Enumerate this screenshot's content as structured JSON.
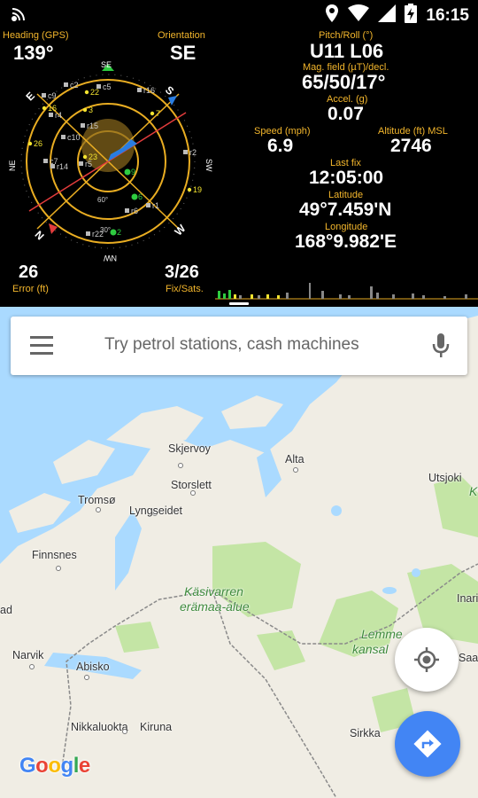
{
  "status_bar": {
    "time": "16:15",
    "icons": [
      "location-icon",
      "wifi-icon",
      "cell-signal-icon",
      "battery-charging-icon"
    ]
  },
  "gps": {
    "heading": {
      "label": "Heading (GPS)",
      "value": "139°"
    },
    "orientation": {
      "label": "Orientation",
      "value": "SE"
    },
    "pitch_roll": {
      "label": "Pitch/Roll (°)",
      "value": "U11 L06"
    },
    "mag_field": {
      "label": "Mag. field (µT)/decl.",
      "value": "65/50/17°"
    },
    "accel": {
      "label": "Accel. (g)",
      "value": "0.07"
    },
    "speed": {
      "label": "Speed (mph)",
      "value": "6.9"
    },
    "altitude": {
      "label": "Altitude (ft) MSL",
      "value": "2746"
    },
    "last_fix": {
      "label": "Last fix",
      "value": "12:05:00"
    },
    "latitude": {
      "label": "Latitude",
      "value": "49°7.459'N"
    },
    "longitude": {
      "label": "Longitude",
      "value": "168°9.982'E"
    },
    "error": {
      "label": "Error (ft)",
      "value": "26"
    },
    "fix_sats": {
      "label": "Fix/Sats.",
      "value": "3/26"
    },
    "compass": {
      "cardinals": {
        "n": "N",
        "e": "E",
        "s": "S",
        "w": "W",
        "ne": "NE",
        "se": "SE",
        "sw": "SW",
        "nw": "NW"
      },
      "ring_labels": {
        "inner": "60°",
        "outer": "30°"
      },
      "satellites": [
        "c9",
        "c2",
        "22",
        "c5",
        "r16",
        "16",
        "r4",
        "3",
        "7",
        "c10",
        "r15",
        "26",
        "c7",
        "23",
        "r5",
        "r14",
        "r2",
        "9",
        "6",
        "19",
        "r6",
        "r1",
        "r22",
        "2"
      ]
    },
    "colors": {
      "label": "#f3b62c",
      "ring": "#e9ad22",
      "pointer_red": "#e23c3c",
      "pointer_blue": "#2a7de1",
      "sat_green": "#2ecc40",
      "sat_yellow": "#f4e430"
    }
  },
  "map": {
    "search_placeholder": "Try petrol stations, cash machines",
    "places": {
      "skjervoy": "Skjervoy",
      "alta": "Alta",
      "tromso": "Tromsø",
      "storslett": "Storslett",
      "lyngseidet": "Lyngseidet",
      "utsjoki": "Utsjoki",
      "finnsnes": "Finnsnes",
      "kasivarren": "Käsivarren",
      "eramaa": "erämaa-alue",
      "lemme": "Lemme",
      "kansal": "kansal",
      "narvik": "Narvik",
      "abisko": "Abisko",
      "nikkaluokta": "Nikkaluokta",
      "kiruna": "Kiruna",
      "sirkka": "Sirkka",
      "inari": "Inari",
      "saa": "Saa",
      "ad": "ad",
      "k": "K"
    },
    "logo": "Google",
    "colors": {
      "water": "#aadaff",
      "land": "#f0ede4",
      "park": "#c4e5a5",
      "border": "#8a8a8a",
      "fab_blue": "#4285f4"
    }
  }
}
